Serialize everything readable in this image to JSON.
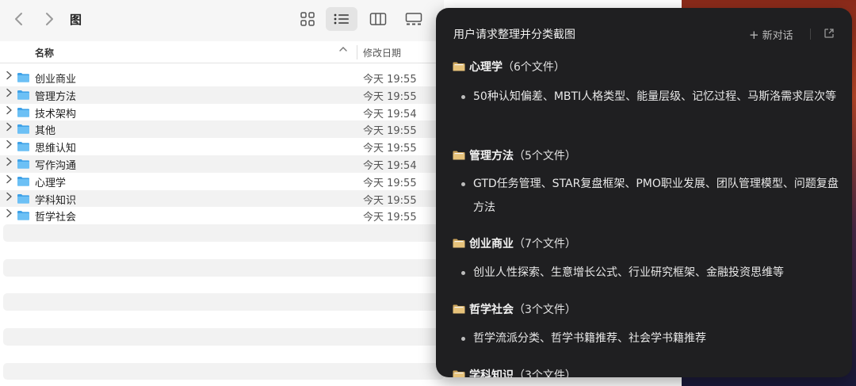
{
  "finder": {
    "title": "图",
    "columns": {
      "name": "名称",
      "date": "修改日期"
    },
    "rows": [
      {
        "name": "创业商业",
        "date": "今天 19:55"
      },
      {
        "name": "管理方法",
        "date": "今天 19:55"
      },
      {
        "name": "技术架构",
        "date": "今天 19:54"
      },
      {
        "name": "其他",
        "date": "今天 19:55"
      },
      {
        "name": "思维认知",
        "date": "今天 19:55"
      },
      {
        "name": "写作沟通",
        "date": "今天 19:54"
      },
      {
        "name": "心理学",
        "date": "今天 19:55"
      },
      {
        "name": "学科知识",
        "date": "今天 19:55"
      },
      {
        "name": "哲学社会",
        "date": "今天 19:55"
      }
    ],
    "folder_color": "#3fa2e8"
  },
  "chat": {
    "title": "用户请求整理并分类截图",
    "new_chat_label": "新对话",
    "sections": [
      {
        "name": "心理学",
        "count": "（6个文件）",
        "desc": "50种认知偏差、MBTI人格类型、能量层级、记忆过程、马斯洛需求层次等"
      },
      {
        "name": "管理方法",
        "count": "（5个文件）",
        "desc": "GTD任务管理、STAR复盘框架、PMO职业发展、团队管理模型、问题复盘方法"
      },
      {
        "name": "创业商业",
        "count": "（7个文件）",
        "desc": "创业人性探索、生意增长公式、行业研究框架、金融投资思维等"
      },
      {
        "name": "哲学社会",
        "count": "（3个文件）",
        "desc": "哲学流派分类、哲学书籍推荐、社会学书籍推荐"
      },
      {
        "name": "学科知识",
        "count": "（3个文件）",
        "desc": ""
      }
    ]
  }
}
